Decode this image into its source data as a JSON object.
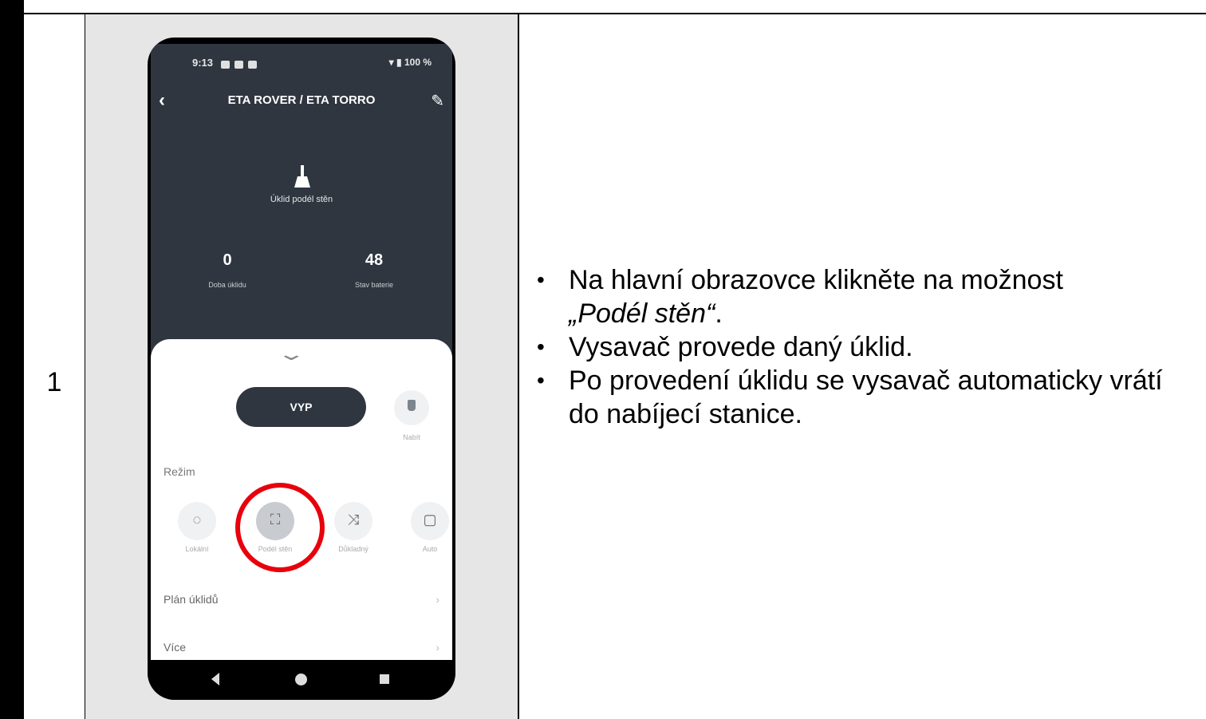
{
  "step": {
    "number": "1"
  },
  "phone": {
    "status_time": "9:13",
    "status_battery": "100 %",
    "title": "ETA ROVER / ETA TORRO",
    "mode_label": "Úklid podél stěn",
    "stats": [
      {
        "value": "0",
        "label": "Doba úklidu"
      },
      {
        "value": "48",
        "label": "Stav baterie"
      }
    ],
    "power_button": "VYP",
    "charge_label": "Nabít",
    "section_mode": "Režim",
    "modes": [
      {
        "label": "Lokální",
        "icon": "target-icon"
      },
      {
        "label": "Podél stěn",
        "icon": "frame-corners-icon"
      },
      {
        "label": "Důkladný",
        "icon": "shuffle-icon"
      },
      {
        "label": "Auto",
        "icon": "square-icon"
      }
    ],
    "rows": [
      {
        "label": "Plán úklidů"
      },
      {
        "label": "Více"
      }
    ],
    "highlight_color": "#e8000c"
  },
  "instructions": {
    "item1_text": "Na hlavní obrazovce klikněte na možnost",
    "item1_em": "„Podél stěn“",
    "item1_end": ".",
    "item2": "Vysavač provede daný úklid.",
    "item3": "Po provedení úklidu se vysavač automaticky vrátí do nabíjecí stanice."
  }
}
